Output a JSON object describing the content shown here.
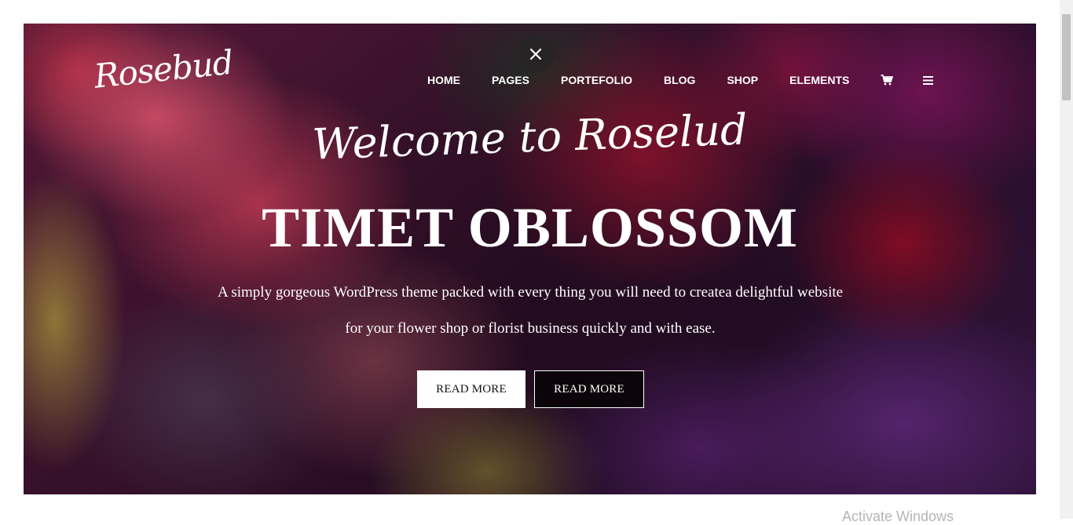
{
  "brand": {
    "logo_text": "Rosebud"
  },
  "nav": {
    "items": [
      "HOME",
      "PAGES",
      "PORTEFOLIO",
      "BLOG",
      "SHOP",
      "ELEMENTS"
    ],
    "icons": [
      "cart-icon",
      "menu-icon"
    ],
    "close_icon": "close-icon"
  },
  "hero": {
    "welcome": "Welcome to Roselud",
    "title": "TIMET OBLOSSOM",
    "description": "A simply gorgeous WordPress theme packed with every thing you will need to createa delightful website for your flower shop or florist business quickly and with ease.",
    "buttons": [
      "READ MORE",
      "READ MORE"
    ]
  },
  "system": {
    "watermark": "Activate Windows"
  },
  "colors": {
    "text": "#ffffff",
    "button_light_bg": "#ffffff",
    "button_dark_bg": "#0a0408"
  }
}
